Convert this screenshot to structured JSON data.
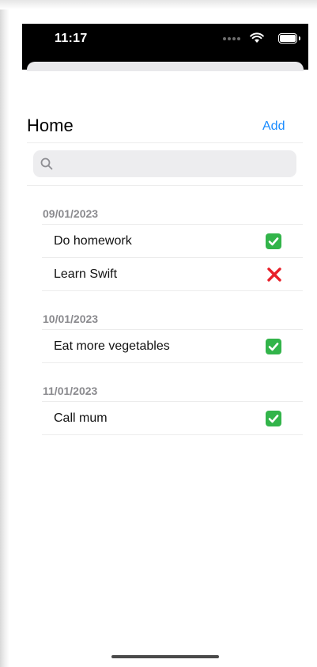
{
  "status_bar": {
    "time": "11:17"
  },
  "nav": {
    "title": "Home",
    "add_label": "Add"
  },
  "search": {
    "placeholder": ""
  },
  "sections": [
    {
      "date": "09/01/2023",
      "items": [
        {
          "title": "Do homework",
          "status": "done"
        },
        {
          "title": "Learn Swift",
          "status": "not-done"
        }
      ]
    },
    {
      "date": "10/01/2023",
      "items": [
        {
          "title": "Eat more vegetables",
          "status": "done"
        }
      ]
    },
    {
      "date": "11/01/2023",
      "items": [
        {
          "title": "Call mum",
          "status": "done"
        }
      ]
    }
  ],
  "icons": {
    "done": "check-icon",
    "not_done": "cross-icon",
    "search": "search-icon"
  },
  "colors": {
    "accent": "#1a8cff",
    "done": "#32b44a",
    "not_done": "#e8202a"
  }
}
